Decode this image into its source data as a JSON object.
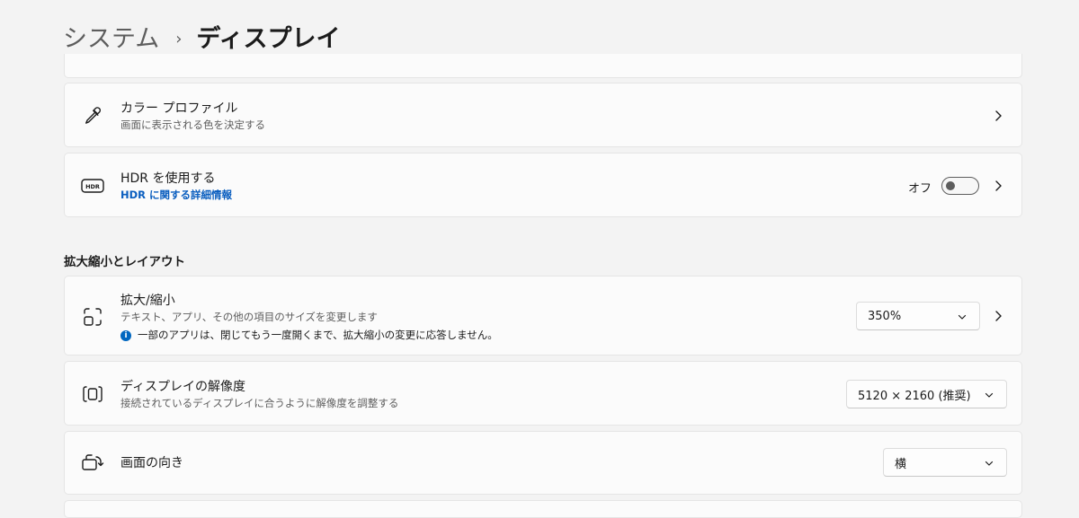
{
  "breadcrumb": {
    "parent": "システム",
    "separator": "›",
    "current": "ディスプレイ"
  },
  "color_profile": {
    "title": "カラー プロファイル",
    "description": "画面に表示される色を決定する",
    "icon": "eyedropper-icon"
  },
  "hdr": {
    "title": "HDR を使用する",
    "link": "HDR に関する詳細情報",
    "toggle_label": "オフ",
    "toggle_on": false,
    "icon": "hdr-icon"
  },
  "section": {
    "scale_layout_title": "拡大縮小とレイアウト"
  },
  "scale": {
    "title": "拡大/縮小",
    "description": "テキスト、アプリ、その他の項目のサイズを変更します",
    "notice": "一部のアプリは、閉じてもう一度開くまで、拡大縮小の変更に応答しません。",
    "notice_icon_glyph": "i",
    "value": "350%",
    "icon": "scale-icon"
  },
  "resolution": {
    "title": "ディスプレイの解像度",
    "description": "接続されているディスプレイに合うように解像度を調整する",
    "value": "5120 × 2160 (推奨)",
    "icon": "resolution-icon"
  },
  "orientation": {
    "title": "画面の向き",
    "value": "横",
    "icon": "orientation-icon"
  },
  "colors": {
    "accent": "#0067c0",
    "link": "#0a5ebf"
  }
}
